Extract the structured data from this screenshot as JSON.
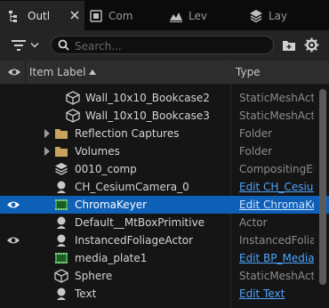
{
  "tabs": [
    {
      "label": "Outl",
      "icon": "outliner-icon",
      "active": true,
      "closable": true
    },
    {
      "label": "Com",
      "icon": "component-icon",
      "active": false
    },
    {
      "label": "Lev",
      "icon": "levels-icon",
      "active": false
    },
    {
      "label": "Lay",
      "icon": "layers-icon",
      "active": false
    }
  ],
  "toolbar": {
    "filter_icon": "filter-icon",
    "search_placeholder": "Search...",
    "add_folder_icon": "add-folder-icon",
    "settings_icon": "gear-icon"
  },
  "header": {
    "item_label": "Item Label",
    "sort": "ascending",
    "type": "Type"
  },
  "rows": [
    {
      "label": "Wall_10x10_Bookcase2",
      "type": "StaticMeshAct",
      "icon": "static-mesh-icon",
      "type_link": false,
      "visible_eye": false,
      "selected": false
    },
    {
      "label": "Wall_10x10_Bookcase3",
      "type": "StaticMeshAct",
      "icon": "static-mesh-icon",
      "type_link": false,
      "visible_eye": false,
      "selected": false
    },
    {
      "label": "Reflection Captures",
      "type": "Folder",
      "icon": "folder-icon",
      "type_link": false,
      "expand": true,
      "visible_eye": false,
      "selected": false
    },
    {
      "label": "Volumes",
      "type": "Folder",
      "icon": "folder-icon",
      "type_link": false,
      "expand": true,
      "visible_eye": false,
      "selected": false
    },
    {
      "label": "0010_comp",
      "type": "CompositingEle",
      "icon": "compositing-icon",
      "type_link": false,
      "visible_eye": false,
      "selected": false
    },
    {
      "label": "CH_CesiumCamera_0",
      "type": "Edit CH_Cesium",
      "icon": "actor-icon",
      "type_link": true,
      "visible_eye": false,
      "selected": false
    },
    {
      "label": "ChromaKeyer",
      "type": "Edit ChromaKey",
      "icon": "media-plate-icon",
      "type_link": true,
      "visible_eye": true,
      "selected": true
    },
    {
      "label": "Default__MtBoxPrimitive",
      "type": "Actor",
      "icon": "actor-icon",
      "type_link": false,
      "visible_eye": false,
      "selected": false
    },
    {
      "label": "InstancedFoliageActor",
      "type": "InstancedFolia",
      "icon": "actor-icon",
      "type_link": false,
      "visible_eye": true,
      "selected": false
    },
    {
      "label": "media_plate1",
      "type": "Edit BP_Media",
      "icon": "media-plate-icon",
      "type_link": true,
      "visible_eye": false,
      "selected": false
    },
    {
      "label": "Sphere",
      "type": "StaticMeshAct",
      "icon": "static-mesh-icon",
      "type_link": false,
      "visible_eye": false,
      "selected": false
    },
    {
      "label": "Text",
      "type": "Edit Text",
      "icon": "actor-icon",
      "type_link": true,
      "visible_eye": false,
      "selected": false
    }
  ],
  "colors": {
    "selection": "#0e5fb6",
    "link": "#4da3ff",
    "folder": "#c9a35c"
  }
}
